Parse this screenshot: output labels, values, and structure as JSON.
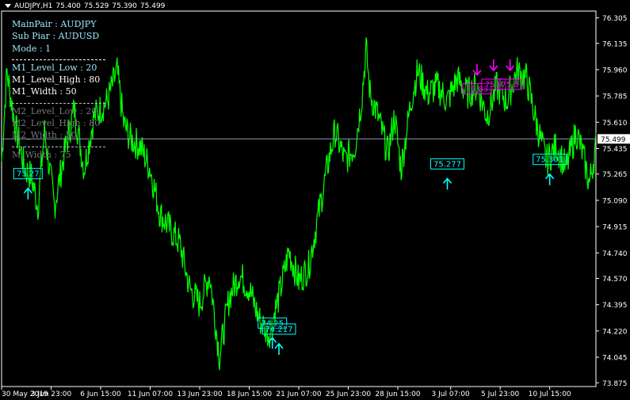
{
  "window": {
    "symbol": "AUDJPY,H1",
    "open": "75.400",
    "high": "75.529",
    "low": "75.390",
    "close": "75.499"
  },
  "params": [
    {
      "text": "MainPair : AUDJPY",
      "style": "cyan"
    },
    {
      "text": "Sub Piar : AUDUSD",
      "style": "cyan"
    },
    {
      "text": "Mode : 1",
      "style": "cyan"
    },
    {
      "sep": true,
      "style": "bright"
    },
    {
      "text": "M1_Level_Low : 20",
      "style": "cyan"
    },
    {
      "text": "M1_Level_High : 80",
      "style": "bright"
    },
    {
      "text": "M1_Width : 50",
      "style": "bright"
    },
    {
      "sep": true,
      "style": "grey"
    },
    {
      "text": "M2_Level_Low : 20",
      "style": "dim"
    },
    {
      "text": "M2_Level_High : 80",
      "style": "dim"
    },
    {
      "text": "M2_Width : 50",
      "style": "dim"
    },
    {
      "sep": true,
      "style": "grey"
    },
    {
      "text": "M_Width : 75",
      "style": "dim"
    }
  ],
  "chart_data": {
    "type": "line",
    "series_name": "AUDJPY,H1",
    "line_color": "#00ff00",
    "ylim": [
      73.85,
      76.35
    ],
    "y_ticks": [
      "76.305",
      "76.135",
      "75.960",
      "75.785",
      "75.610",
      "75.435",
      "75.265",
      "75.090",
      "74.915",
      "74.740",
      "74.570",
      "74.395",
      "74.220",
      "74.045",
      "73.875"
    ],
    "x_ticks": [
      "30 May 2019",
      "3 Jun 23:00",
      "6 Jun 15:00",
      "11 Jun 07:00",
      "13 Jun 23:00",
      "18 Jun 15:00",
      "21 Jun 07:00",
      "25 Jun 23:00",
      "28 Jun 15:00",
      "3 Jul 07:00",
      "5 Jul 23:00",
      "10 Jul 15:00"
    ],
    "current_price": 75.499,
    "current_price_label": "75.499",
    "bars_total": 900,
    "anchors": [
      [
        0,
        75.35
      ],
      [
        8,
        75.95
      ],
      [
        20,
        75.6
      ],
      [
        35,
        75.3
      ],
      [
        45,
        75.25
      ],
      [
        55,
        75.05
      ],
      [
        65,
        75.55
      ],
      [
        80,
        75.05
      ],
      [
        95,
        75.4
      ],
      [
        110,
        75.7
      ],
      [
        125,
        75.3
      ],
      [
        140,
        75.65
      ],
      [
        160,
        75.75
      ],
      [
        175,
        75.95
      ],
      [
        185,
        75.6
      ],
      [
        195,
        75.5
      ],
      [
        210,
        75.45
      ],
      [
        225,
        75.3
      ],
      [
        240,
        75.0
      ],
      [
        255,
        74.9
      ],
      [
        270,
        74.8
      ],
      [
        285,
        74.5
      ],
      [
        300,
        74.4
      ],
      [
        315,
        74.6
      ],
      [
        330,
        74.05
      ],
      [
        345,
        74.45
      ],
      [
        360,
        74.6
      ],
      [
        375,
        74.5
      ],
      [
        390,
        74.3
      ],
      [
        405,
        74.2
      ],
      [
        420,
        74.45
      ],
      [
        435,
        74.75
      ],
      [
        450,
        74.55
      ],
      [
        465,
        74.65
      ],
      [
        480,
        75.0
      ],
      [
        495,
        75.35
      ],
      [
        505,
        75.55
      ],
      [
        520,
        75.35
      ],
      [
        535,
        75.45
      ],
      [
        545,
        75.75
      ],
      [
        552,
        76.1
      ],
      [
        558,
        75.8
      ],
      [
        570,
        75.65
      ],
      [
        585,
        75.4
      ],
      [
        595,
        75.65
      ],
      [
        605,
        75.3
      ],
      [
        620,
        75.75
      ],
      [
        630,
        75.95
      ],
      [
        645,
        75.8
      ],
      [
        660,
        75.85
      ],
      [
        675,
        75.75
      ],
      [
        690,
        75.9
      ],
      [
        705,
        75.8
      ],
      [
        720,
        75.85
      ],
      [
        735,
        75.65
      ],
      [
        750,
        75.85
      ],
      [
        765,
        75.75
      ],
      [
        780,
        75.95
      ],
      [
        795,
        75.9
      ],
      [
        810,
        75.6
      ],
      [
        825,
        75.35
      ],
      [
        840,
        75.45
      ],
      [
        855,
        75.3
      ],
      [
        870,
        75.55
      ],
      [
        880,
        75.4
      ],
      [
        890,
        75.2
      ],
      [
        900,
        75.45
      ]
    ],
    "signals": [
      {
        "label": "75.27",
        "direction": "up",
        "bar": 40,
        "price": 75.265
      },
      {
        "label": "74.25",
        "direction": "up",
        "bar": 410,
        "price": 74.27
      },
      {
        "label": "74.217",
        "direction": "up",
        "bar": 420,
        "price": 74.23
      },
      {
        "label": "75.277",
        "direction": "up",
        "bar": 675,
        "price": 75.33
      },
      {
        "label": "75.83",
        "direction": "down",
        "bar": 720,
        "price": 75.83
      },
      {
        "label": "75.8",
        "direction": "down",
        "bar": 745,
        "price": 75.86
      },
      {
        "label": "75.8",
        "direction": "down",
        "bar": 770,
        "price": 75.86
      },
      {
        "label": "75.301",
        "direction": "up",
        "bar": 830,
        "price": 75.36
      }
    ],
    "up_color": "#00ffff",
    "down_color": "#ff00ff"
  }
}
